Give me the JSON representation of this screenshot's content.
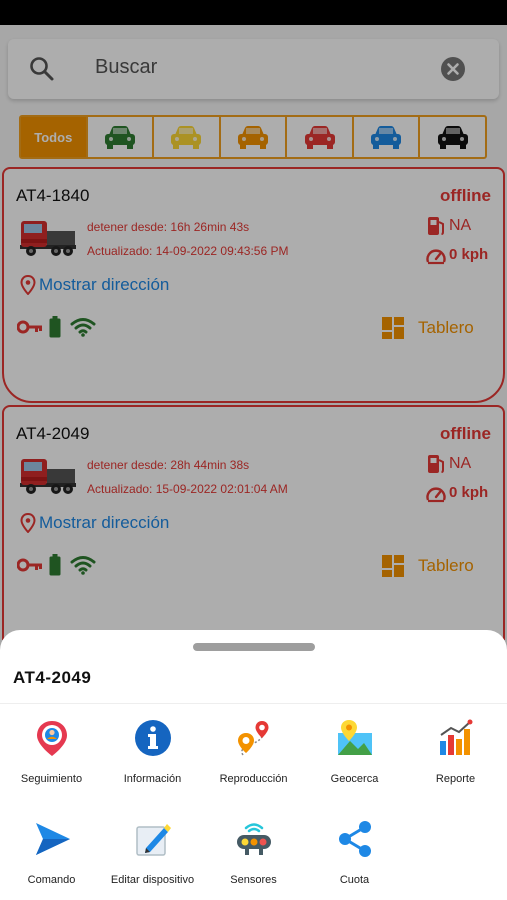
{
  "search": {
    "placeholder": "Buscar"
  },
  "filters": {
    "all_label": "Todos",
    "car_colors": [
      "#2e7d32",
      "#fdd835",
      "#f39200",
      "#e53935",
      "#1e88e5",
      "#111111"
    ]
  },
  "colors": {
    "accent": "#f39200",
    "offline": "#e53935",
    "link": "#1e88e5",
    "online_green": "#2e7d32"
  },
  "devices": [
    {
      "plate": "AT4-1840",
      "status": "offline",
      "stopped_since": "detener desde: 16h 26min 43s",
      "updated": "Actualizado: 14-09-2022 09:43:56 PM",
      "fuel": "NA",
      "speed": "0 kph",
      "address_link": "Mostrar dirección",
      "dashboard_label": "Tablero"
    },
    {
      "plate": "AT4-2049",
      "status": "offline",
      "stopped_since": "detener desde: 28h 44min 38s",
      "updated": "Actualizado: 15-09-2022 02:01:04 AM",
      "fuel": "NA",
      "speed": "0 kph",
      "address_link": "Mostrar dirección",
      "dashboard_label": "Tablero"
    }
  ],
  "sheet": {
    "title": "AT4-2049",
    "actions": [
      {
        "label": "Seguimiento",
        "icon": "tracking-pin-icon"
      },
      {
        "label": "Información",
        "icon": "info-icon"
      },
      {
        "label": "Reproducción",
        "icon": "route-playback-icon"
      },
      {
        "label": "Geocerca",
        "icon": "geofence-map-icon"
      },
      {
        "label": "Reporte",
        "icon": "report-chart-icon"
      },
      {
        "label": "Comando",
        "icon": "send-command-icon"
      },
      {
        "label": "Editar dispositivo",
        "icon": "edit-device-icon"
      },
      {
        "label": "Sensores",
        "icon": "sensors-icon"
      },
      {
        "label": "Cuota",
        "icon": "share-icon"
      }
    ]
  }
}
